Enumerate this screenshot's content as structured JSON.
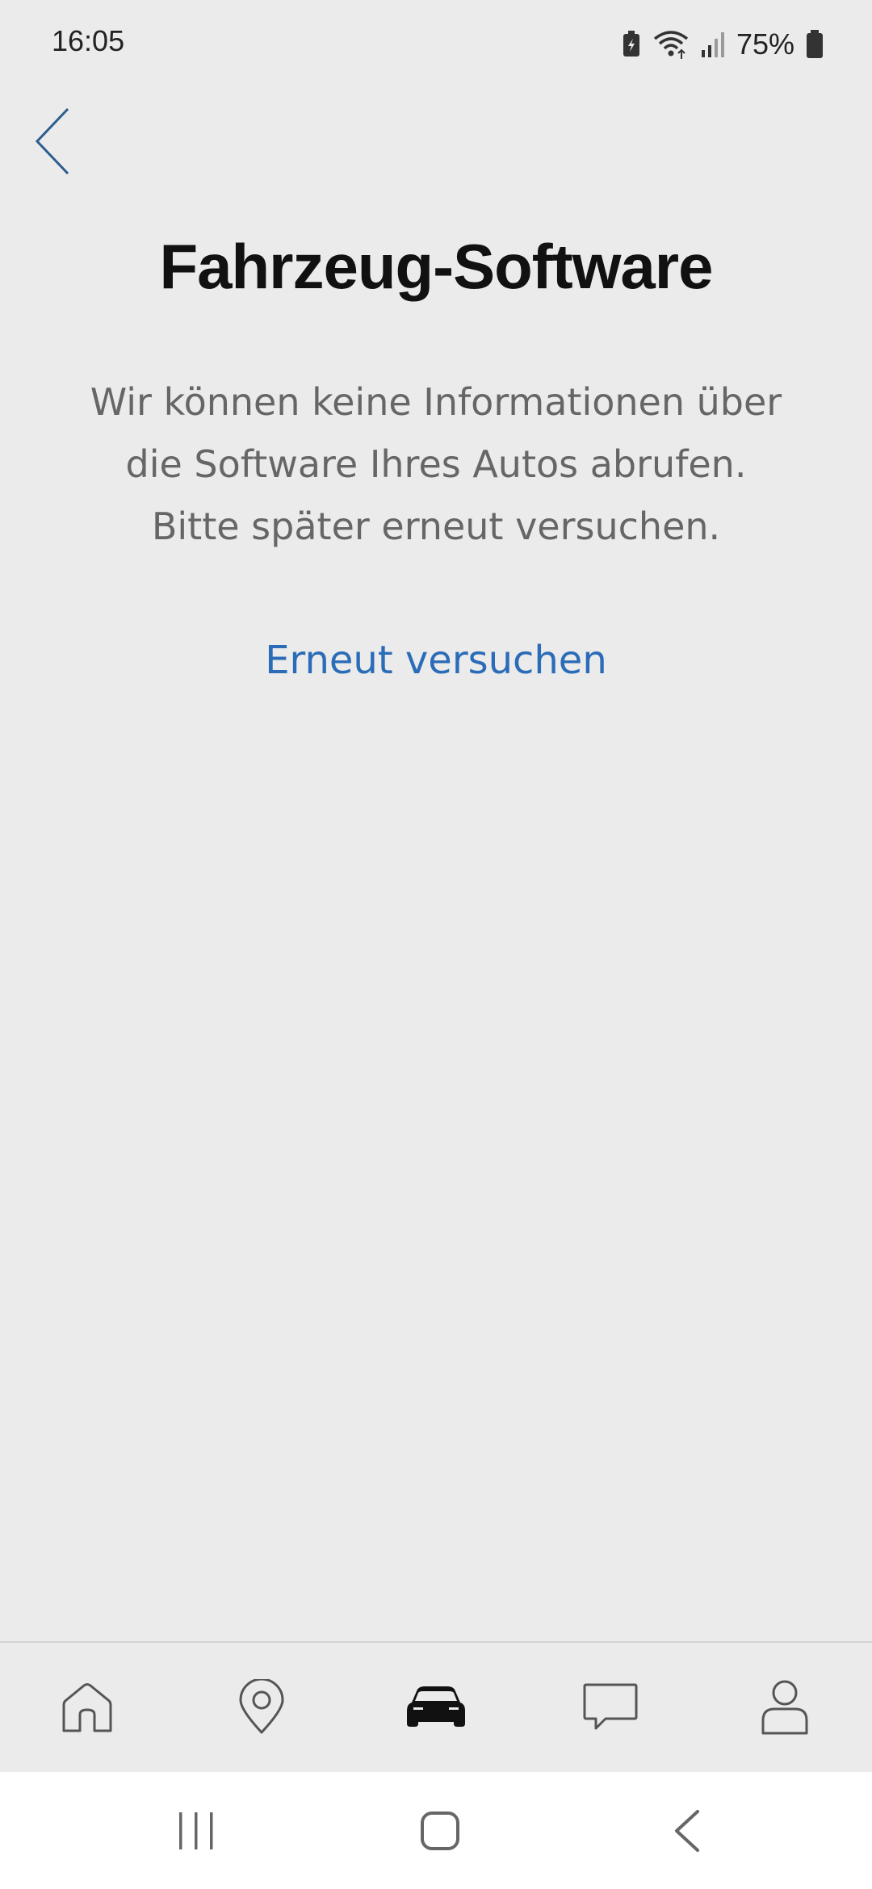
{
  "status_bar": {
    "time": "16:05",
    "battery_percent": "75%",
    "icons": [
      "battery-saver-icon",
      "wifi-icon",
      "signal-icon",
      "battery-icon"
    ]
  },
  "header": {
    "back_icon": "chevron-left-icon",
    "title": "Fahrzeug-Software"
  },
  "message": {
    "line1": "Wir können keine Informationen über",
    "line2": "die Software Ihres Autos abrufen.",
    "line3": "Bitte später erneut versuchen."
  },
  "retry": {
    "label": "Erneut versuchen"
  },
  "tab_bar": {
    "tabs": [
      {
        "icon": "home-icon",
        "active": false
      },
      {
        "icon": "location-pin-icon",
        "active": false
      },
      {
        "icon": "car-icon",
        "active": true
      },
      {
        "icon": "chat-icon",
        "active": false
      },
      {
        "icon": "profile-icon",
        "active": false
      }
    ]
  },
  "system_nav": {
    "buttons": [
      "recent-apps-icon",
      "home-nav-icon",
      "back-nav-icon"
    ]
  },
  "colors": {
    "background": "#ebebeb",
    "title": "#111111",
    "message": "#666666",
    "link": "#2b6cb8",
    "icon": "#555555",
    "active_icon": "#111111"
  }
}
